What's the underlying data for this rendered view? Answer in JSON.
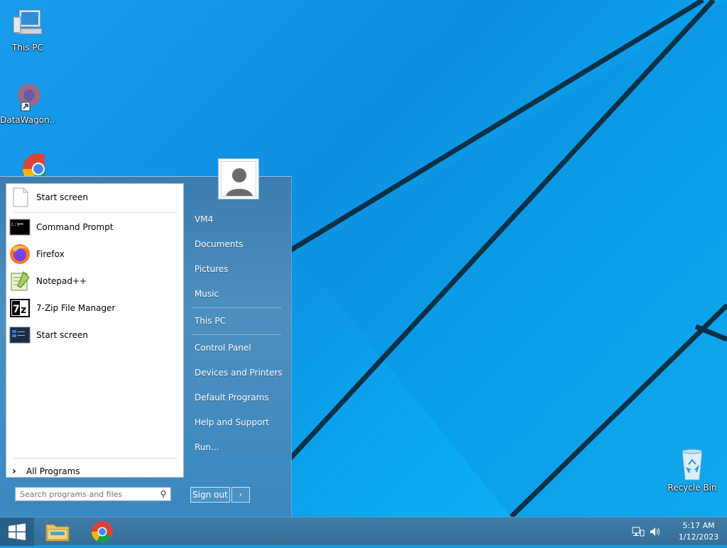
{
  "desktop": {
    "icons": [
      {
        "label": "This PC",
        "icon": "this-pc-icon"
      },
      {
        "label": "DataWagon...",
        "icon": "datawagon-icon"
      },
      {
        "label": "",
        "icon": "chrome-icon"
      },
      {
        "label": "Recycle Bin",
        "icon": "recycle-bin-icon"
      }
    ]
  },
  "start_menu": {
    "programs": [
      {
        "label": "Start screen",
        "icon": "blank-document-icon"
      },
      {
        "label": "Command Prompt",
        "icon": "command-prompt-icon"
      },
      {
        "label": "Firefox",
        "icon": "firefox-icon"
      },
      {
        "label": "Notepad++",
        "icon": "notepadpp-icon"
      },
      {
        "label": "7-Zip File Manager",
        "icon": "7zip-icon"
      },
      {
        "label": "Start screen",
        "icon": "start-screen-icon"
      }
    ],
    "all_programs": "All Programs",
    "search_placeholder": "Search programs and files",
    "right_items": [
      "VM4",
      "Documents",
      "Pictures",
      "Music",
      "This PC",
      "Control Panel",
      "Devices and Printers",
      "Default Programs",
      "Help and Support",
      "Run..."
    ],
    "sign_out": "Sign out",
    "sign_out_arrow": "›"
  },
  "taskbar": {
    "apps": [
      "file-explorer-icon",
      "chrome-icon"
    ],
    "clock": {
      "time": "5:17 AM",
      "date": "1/12/2023"
    }
  },
  "colors": {
    "wallpaper": "#0a9ee9",
    "taskbar": "#3a76a0",
    "start_menu": "#4486b8"
  }
}
